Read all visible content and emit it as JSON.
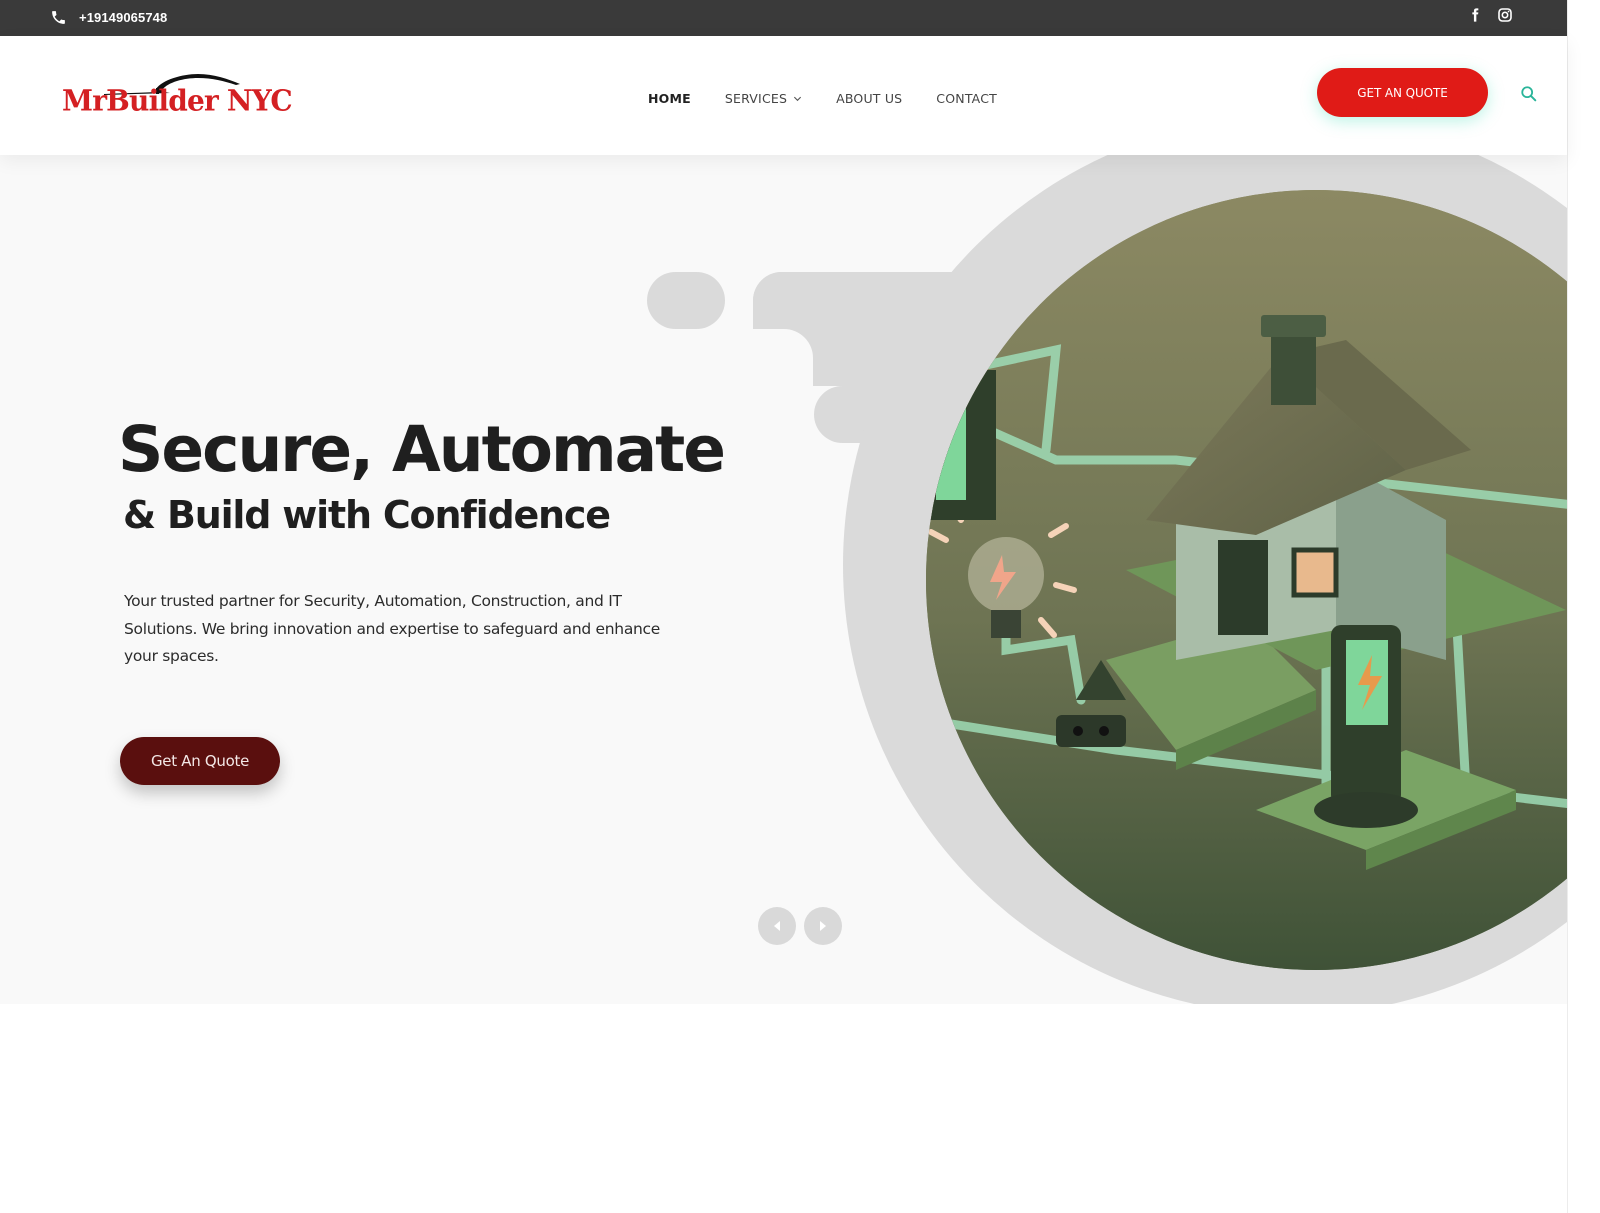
{
  "topbar": {
    "phone": "+19149065748",
    "phone_icon": "phone-icon",
    "social": [
      {
        "name": "facebook",
        "icon": "facebook-icon"
      },
      {
        "name": "instagram",
        "icon": "instagram-icon"
      }
    ]
  },
  "header": {
    "logo_text": "MrBuilder NYC",
    "nav": [
      {
        "label": "HOME",
        "active": true
      },
      {
        "label": "SERVICES",
        "has_dropdown": true
      },
      {
        "label": "ABOUT US"
      },
      {
        "label": "CONTACT"
      }
    ],
    "cta_label": "GET AN QUOTE",
    "search_icon": "search-icon"
  },
  "hero": {
    "title_line1": "Secure, Automate",
    "title_line2": "& Build with Confidence",
    "description": "Your trusted partner for Security, Automation, Construction, and IT Solutions. We bring innovation and expertise to safeguard and enhance your spaces.",
    "cta_label": "Get An Quote",
    "slider": {
      "prev_icon": "arrow-left-icon",
      "next_icon": "arrow-right-icon"
    },
    "illustration": "smart-home-energy-illustration"
  },
  "colors": {
    "topbar_bg": "#3a3a3a",
    "brand_red": "#e01b17",
    "hero_cta": "#5a0f0e",
    "accent_teal": "#2bb59a",
    "hero_bg": "#f9f9f9"
  }
}
